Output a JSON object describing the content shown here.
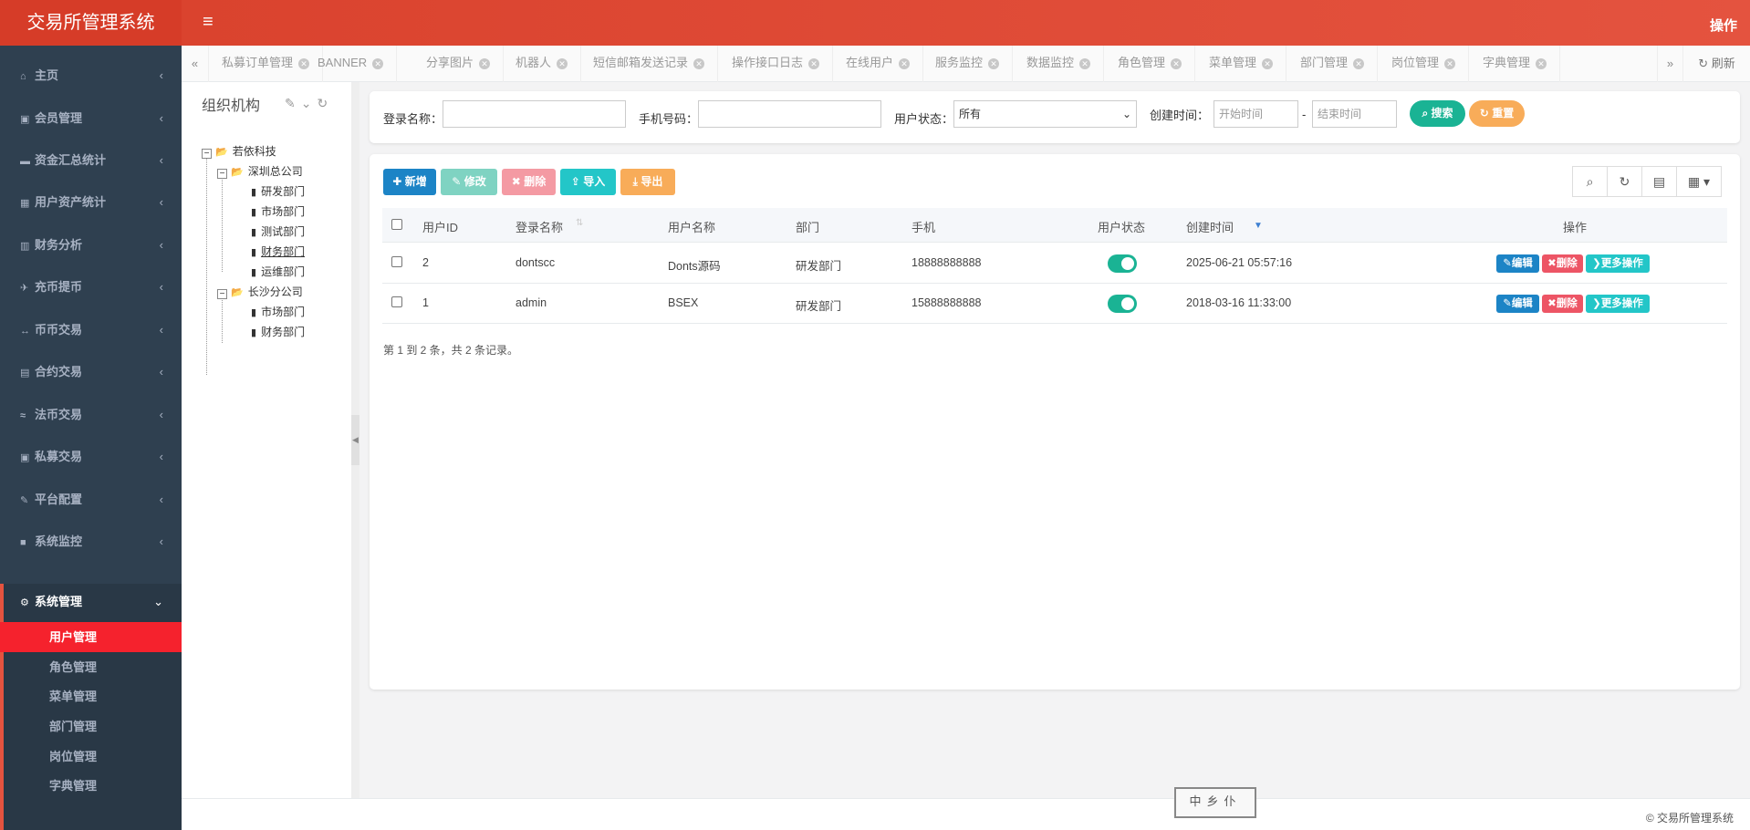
{
  "header": {
    "brand": "交易所管理系统",
    "menu_icon": "≡",
    "ops_label": "操作"
  },
  "sidebar": {
    "items": [
      {
        "label": "主页",
        "icon": "home-icon"
      },
      {
        "label": "会员管理",
        "icon": "user-card-icon"
      },
      {
        "label": "资金汇总统计",
        "icon": "money-icon"
      },
      {
        "label": "用户资产统计",
        "icon": "calculator-icon"
      },
      {
        "label": "财务分析",
        "icon": "bar-chart-icon"
      },
      {
        "label": "充币提币",
        "icon": "plane-icon"
      },
      {
        "label": "币币交易",
        "icon": "exchange-icon"
      },
      {
        "label": "合约交易",
        "icon": "book-icon"
      },
      {
        "label": "法币交易",
        "icon": "money-bill-icon"
      },
      {
        "label": "私募交易",
        "icon": "user-card-icon"
      },
      {
        "label": "平台配置",
        "icon": "wrench-icon"
      },
      {
        "label": "系统监控",
        "icon": "video-icon"
      }
    ],
    "active_group": {
      "label": "系统管理",
      "icon": "gear-icon"
    },
    "sub_items": [
      "用户管理",
      "角色管理",
      "菜单管理",
      "部门管理",
      "岗位管理",
      "字典管理"
    ]
  },
  "tabs": [
    "私募订单管理",
    "BANNER",
    "分享图片",
    "机器人",
    "短信邮箱发送记录",
    "操作接口日志",
    "在线用户",
    "服务监控",
    "数据监控",
    "角色管理",
    "菜单管理",
    "部门管理",
    "岗位管理",
    "字典管理"
  ],
  "tab_refresh": "刷新",
  "org": {
    "title": "组织机构",
    "root": "若依科技",
    "branches": [
      {
        "name": "深圳总公司",
        "depts": [
          "研发部门",
          "市场部门",
          "测试部门",
          "财务部门",
          "运维部门"
        ]
      },
      {
        "name": "长沙分公司",
        "depts": [
          "市场部门",
          "财务部门"
        ]
      }
    ]
  },
  "search": {
    "login_label": "登录名称：",
    "phone_label": "手机号码：",
    "status_label": "用户状态：",
    "status_value": "所有",
    "time_label": "创建时间：",
    "start_placeholder": "开始时间",
    "dash": "-",
    "end_placeholder": "结束时间",
    "search_btn": "搜索",
    "reset_btn": "重置"
  },
  "toolbar": {
    "add": "新增",
    "edit": "修改",
    "delete": "删除",
    "import": "导入",
    "export": "导出"
  },
  "table": {
    "columns": [
      "用户ID",
      "登录名称",
      "用户名称",
      "部门",
      "手机",
      "用户状态",
      "创建时间",
      "操作"
    ],
    "rows": [
      {
        "id": "2",
        "login": "dontscc",
        "name": "Donts源码",
        "dept": "研发部门",
        "phone": "18888888888",
        "status": true,
        "created": "2025-06-21 05:57:16"
      },
      {
        "id": "1",
        "login": "admin",
        "name": "BSEX",
        "dept": "研发部门",
        "phone": "15888888888",
        "status": true,
        "created": "2018-03-16 11:33:00"
      }
    ],
    "row_actions": {
      "edit": "编辑",
      "delete": "删除",
      "more": "更多操作"
    },
    "summary": "第 1 到 2 条，共 2 条记录。"
  },
  "footer": {
    "copyright": "© 交易所管理系统",
    "stamp": "中乡仆"
  },
  "colors": {
    "brand": "#d9412c",
    "sidebar": "#2f4050",
    "primary": "#1c84c6",
    "success": "#1ab394",
    "danger": "#ed5565",
    "warning": "#f8ac59",
    "info": "#23c6c8"
  }
}
